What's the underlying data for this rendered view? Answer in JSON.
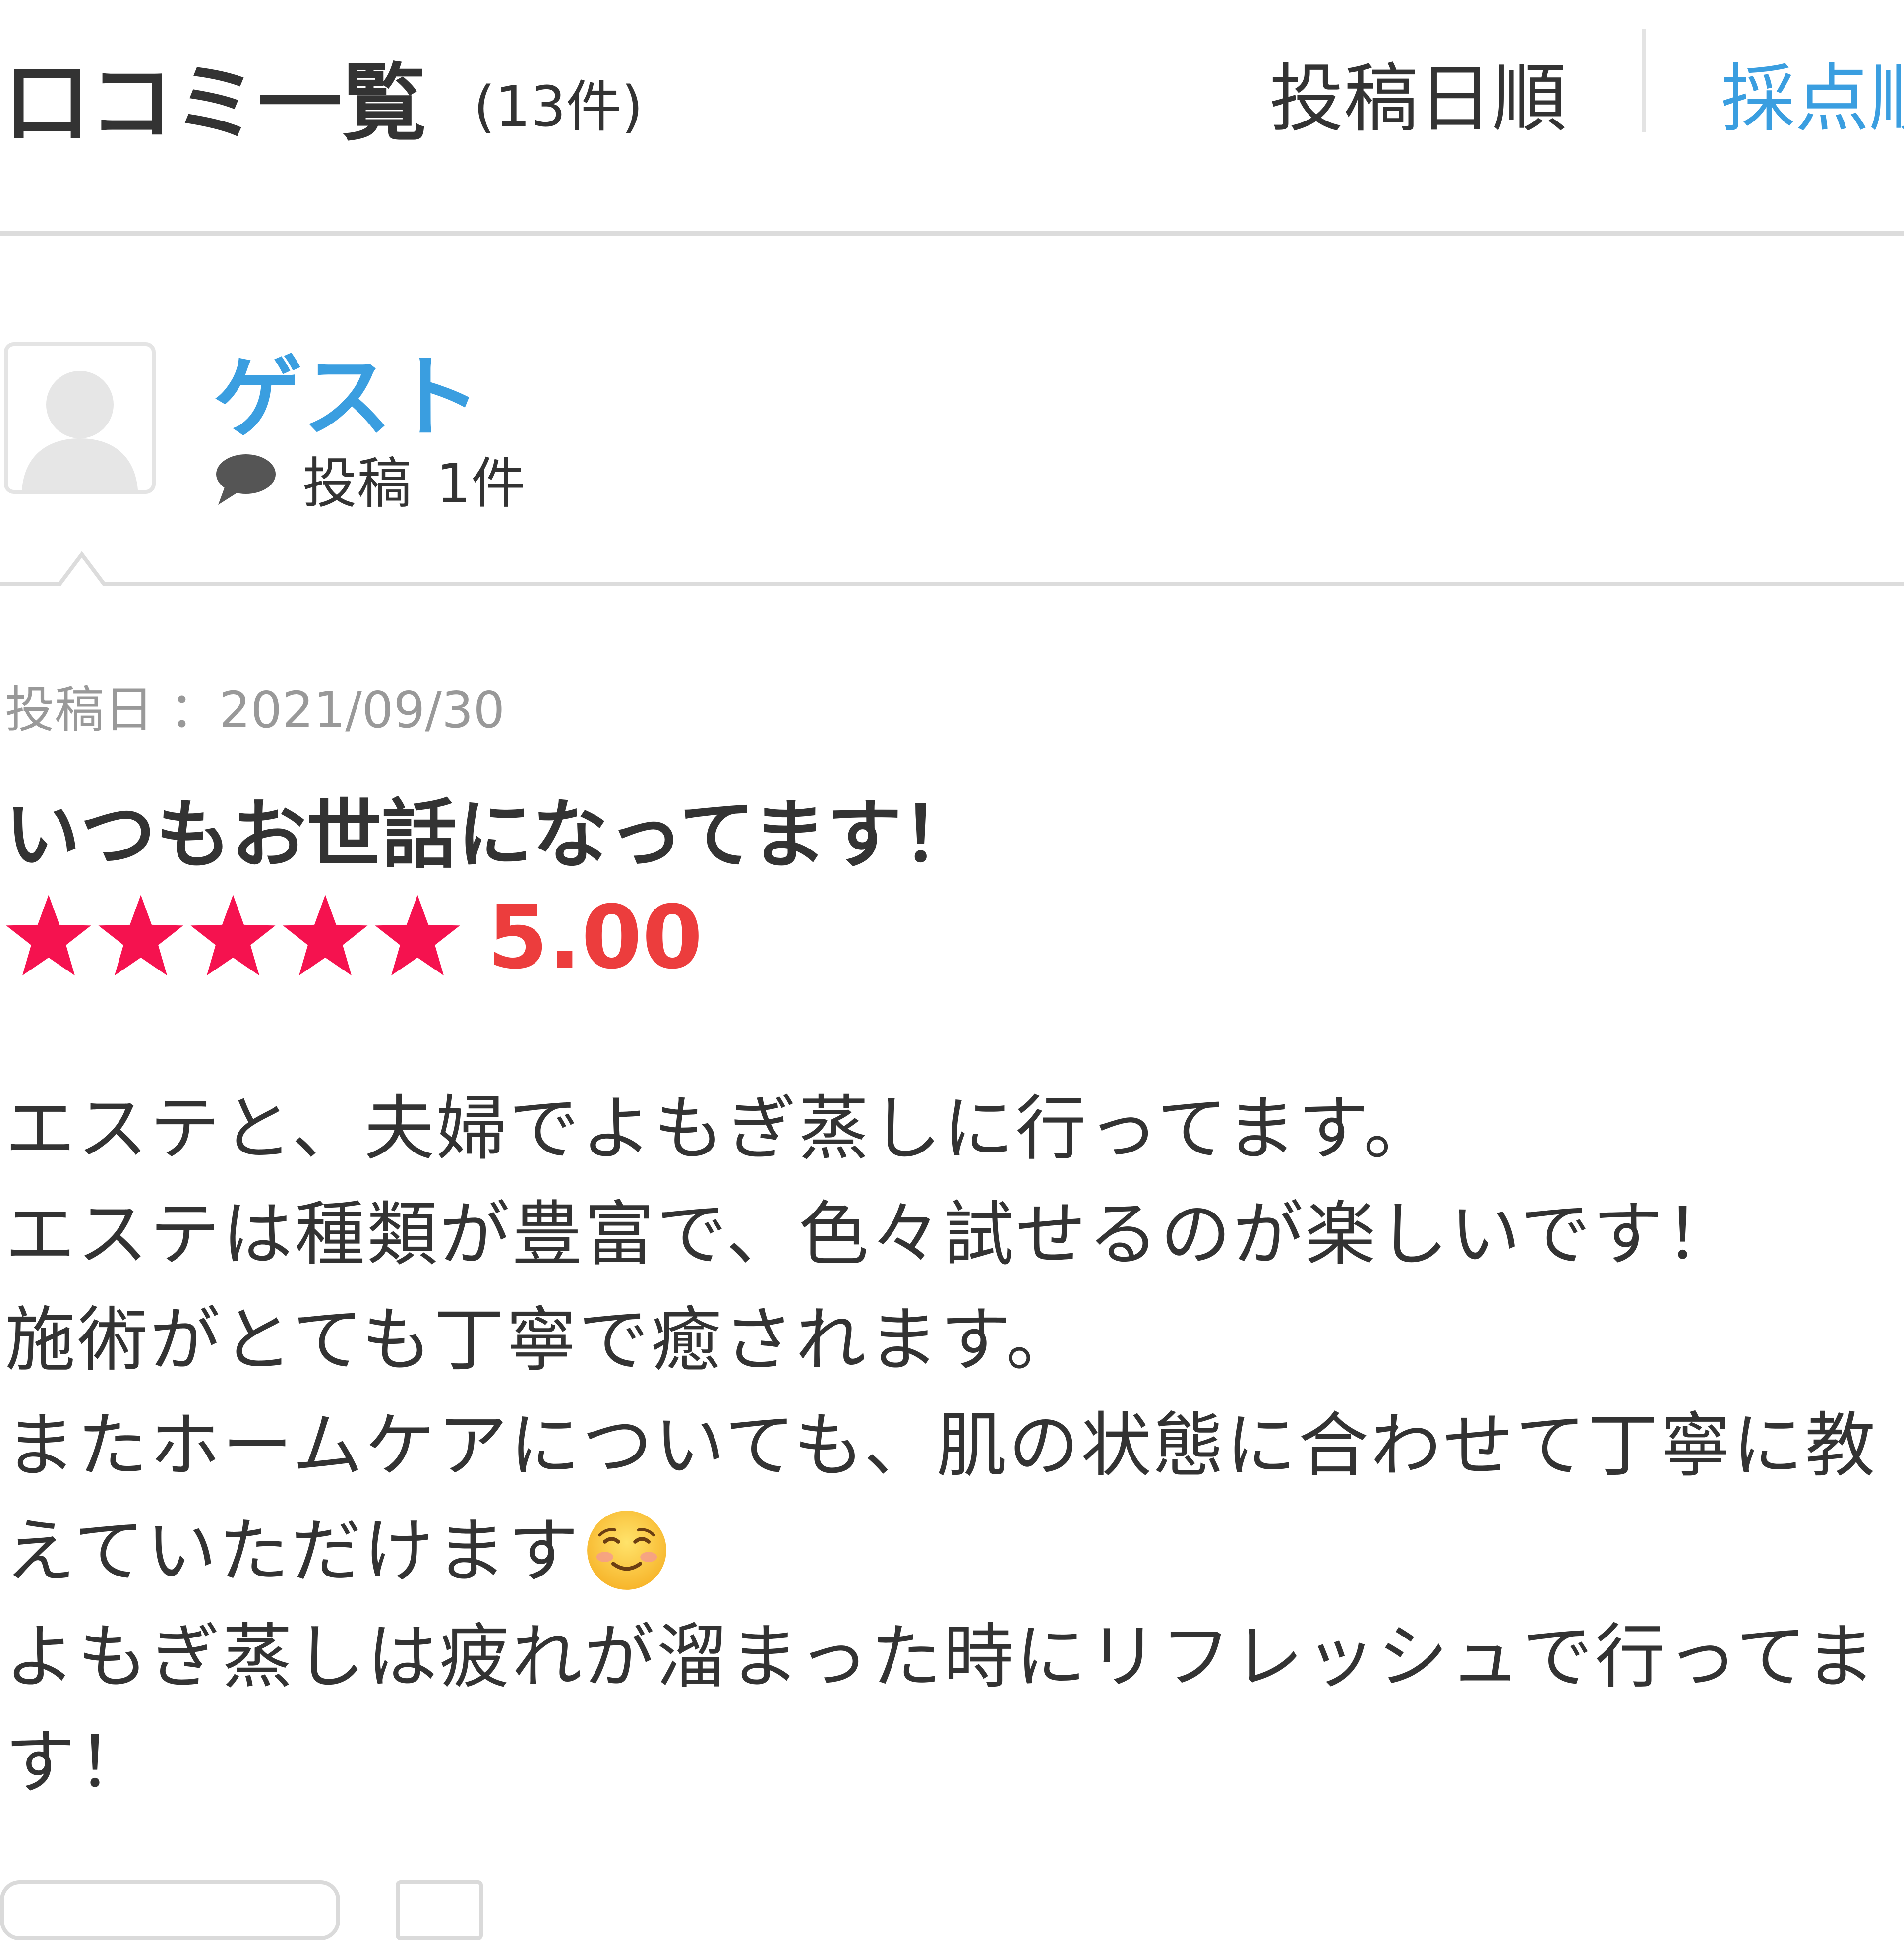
{
  "header": {
    "title": "口コミ一覧",
    "count": "(13件)",
    "sort_options": [
      "投稿日順",
      "採点順"
    ],
    "active_sort": "採点順"
  },
  "reviewer": {
    "name": "ゲスト",
    "post_label": "投稿",
    "post_count": "1件"
  },
  "review": {
    "date": "投稿日 ：2021/09/30",
    "title": "いつもお世話になってます！",
    "rating": 5,
    "rating_text": "5.00",
    "lines": [
      "エステと、夫婦でよもぎ蒸しに行ってます。",
      "エステは種類が豊富で、色々試せるのが楽しいです！",
      "施術がとても丁寧で癒されます。",
      "またホームケアについても、肌の状態に合わせて丁寧に教",
      "えていただけます",
      "よもぎ蒸しは疲れが溜まった時にリフレッシュで行ってま",
      "す！"
    ],
    "emoji": "smiling-face-icon"
  },
  "colors": {
    "link_blue": "#3a9ee0",
    "star_pink": "#f5124f",
    "score_red": "#ec3d3d",
    "text": "#333333",
    "muted": "#999999",
    "rule": "#dcdcdc"
  }
}
